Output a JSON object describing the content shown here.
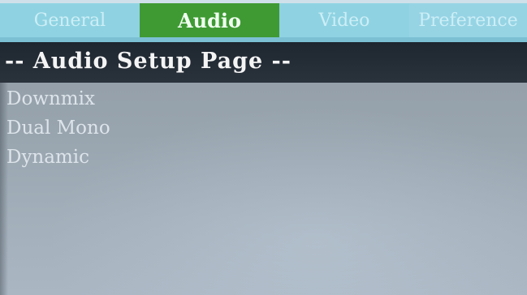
{
  "tabs": {
    "general": "General",
    "audio": "Audio",
    "video": "Video",
    "preference": "Preference",
    "selected": "Audio"
  },
  "header": {
    "title": "-- Audio Setup Page --"
  },
  "menu": {
    "items": [
      {
        "label": "Downmix"
      },
      {
        "label": "Dual Mono"
      },
      {
        "label": "Dynamic"
      }
    ]
  },
  "colors": {
    "selected_tab": "#3f9a34",
    "inactive_tab": "#8fd3e2",
    "header_bar": "#1e2630",
    "background": "#98a4ae"
  }
}
